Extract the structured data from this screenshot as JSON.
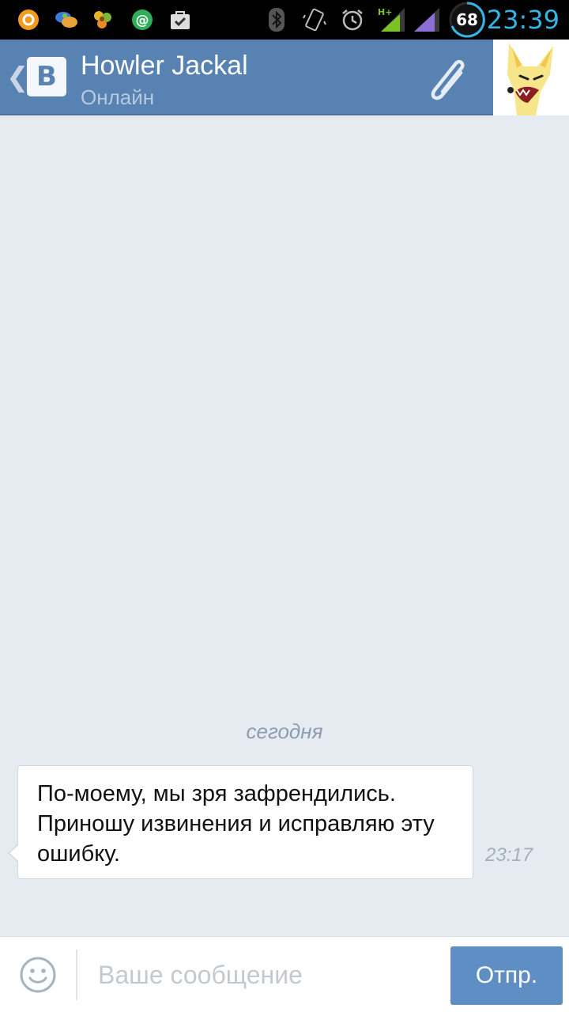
{
  "status_bar": {
    "time": "23:39",
    "battery": "68",
    "network": "H+",
    "left_icons": [
      "odnoklassniki-icon",
      "chat-bubbles-icon",
      "flower-icon",
      "at-sign-icon",
      "bag-check-icon"
    ],
    "right_icons": [
      "bluetooth-icon",
      "vibrate-icon",
      "alarm-icon",
      "signal-icon",
      "signal-icon",
      "battery-icon"
    ]
  },
  "header": {
    "logo": "В",
    "contact_name": "Howler Jackal",
    "contact_status": "Онлайн",
    "back_icon": "chevron-left-icon",
    "attach_icon": "paperclip-icon"
  },
  "conversation": {
    "date_separator": "сегодня",
    "messages": [
      {
        "text": "По-моему, мы зря зафрендились. Приношу извинения и исправляю эту ошибку.",
        "time": "23:17"
      }
    ]
  },
  "composer": {
    "placeholder": "Ваше сообщение",
    "send_label": "Отпр.",
    "emoji_icon": "smiley-icon"
  },
  "colors": {
    "header_bg": "#5782b2",
    "chat_bg": "#e6ebf1",
    "send_button": "#5f8ec5",
    "clock": "#33b5e5"
  }
}
